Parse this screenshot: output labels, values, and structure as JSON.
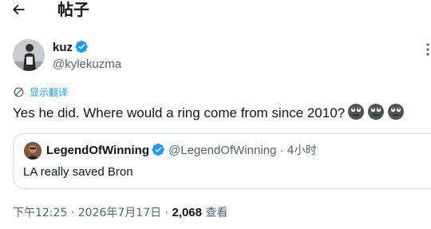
{
  "header": {
    "title": "帖子",
    "back_icon": "arrow-left-icon"
  },
  "author": {
    "display_name": "kuz",
    "handle": "@kylekuzma",
    "verified": true
  },
  "translate": {
    "label": "显示翻译",
    "icon": "translate-icon"
  },
  "tweet": {
    "text": "Yes he did. Where would a ring come from since 2010?",
    "emojis": [
      "face-with-rolling-eyes",
      "face-with-rolling-eyes",
      "face-with-rolling-eyes"
    ]
  },
  "quote": {
    "display_name": "LegendOfWinning",
    "handle": "@LegendOfWinning",
    "separator": "·",
    "time": "4小时",
    "text": "LA really saved Bron",
    "verified": true
  },
  "meta": {
    "time": "下午12:25",
    "separator": "·",
    "date": "2026年7月17日",
    "views_count": "2,068",
    "views_label": "查看"
  },
  "colors": {
    "accent": "#1d9bf0",
    "text": "#0f1419",
    "muted": "#536471",
    "border": "#cfd9de"
  }
}
